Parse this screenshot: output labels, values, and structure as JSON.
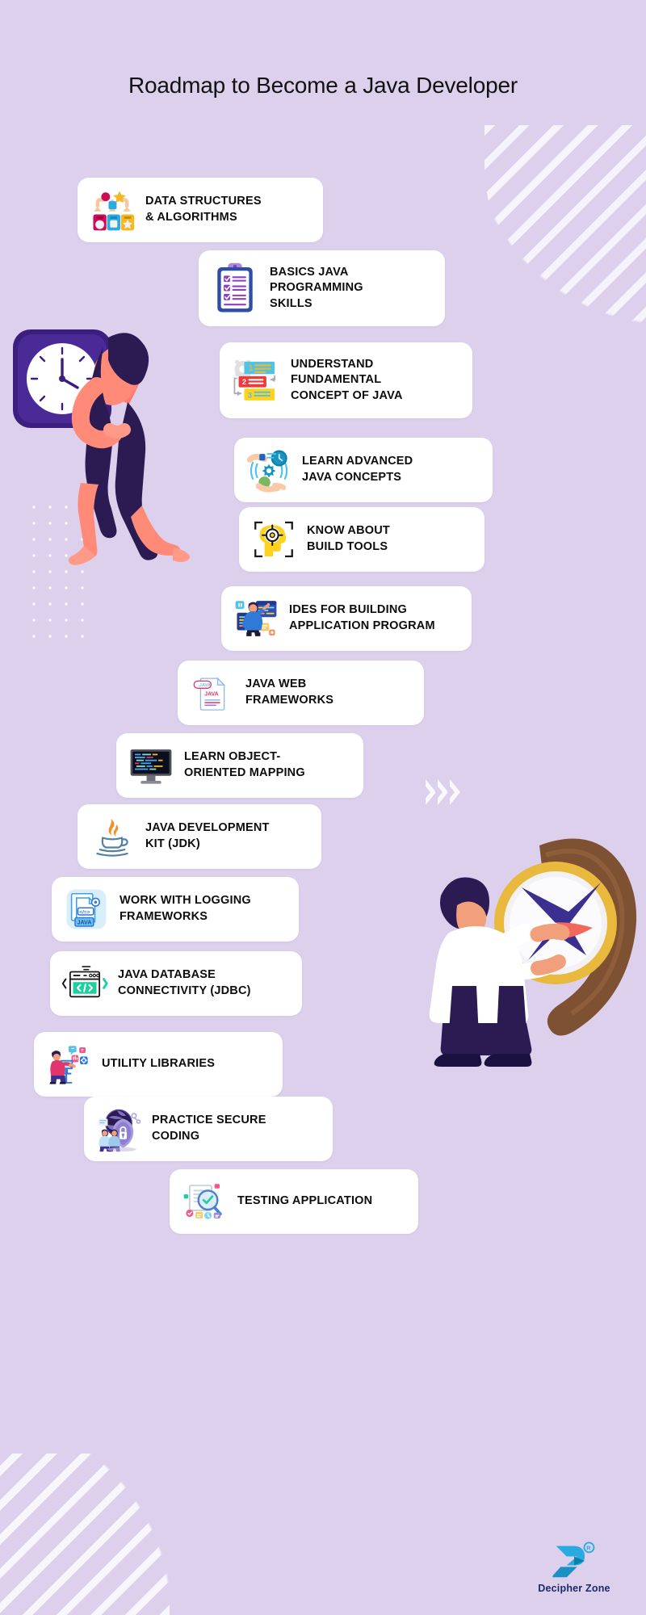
{
  "page": {
    "title": "Roadmap to Become a Java\nDeveloper",
    "background_color": "#DCD0EC",
    "card_color": "#FFFFFF",
    "text_color": "#0D0D0D"
  },
  "steps": [
    {
      "index": 1,
      "label": "DATA STRUCTURES\n& ALGORITHMS",
      "icon": "algorithm-flow-icon"
    },
    {
      "index": 2,
      "label": "BASICS JAVA\nPROGRAMMING\nSKILLS",
      "icon": "clipboard-checklist-icon"
    },
    {
      "index": 3,
      "label": "UNDERSTAND\nFUNDAMENTAL\nCONCEPT OF JAVA",
      "icon": "numbered-steps-gear-icon"
    },
    {
      "index": 4,
      "label": "LEARN ADVANCED\nJAVA CONCEPTS",
      "icon": "gear-clock-hands-icon"
    },
    {
      "index": 5,
      "label": "KNOW ABOUT\nBUILD TOOLS",
      "icon": "head-target-icon"
    },
    {
      "index": 6,
      "label": "IDES FOR BUILDING\nAPPLICATION PROGRAM",
      "icon": "developer-screens-icon"
    },
    {
      "index": 7,
      "label": "JAVA WEB\nFRAMEWORKS",
      "icon": "java-file-icon"
    },
    {
      "index": 8,
      "label": "LEARN OBJECT-\nORIENTED MAPPING",
      "icon": "monitor-code-icon"
    },
    {
      "index": 9,
      "label": "JAVA DEVELOPMENT\nKIT (JDK)",
      "icon": "java-coffee-cup-icon"
    },
    {
      "index": 10,
      "label": "WORK WITH LOGGING\nFRAMEWORKS",
      "icon": "java-documents-icon"
    },
    {
      "index": 11,
      "label": "JAVA DATABASE\nCONNECTIVITY (JDBC)",
      "icon": "code-window-icon"
    },
    {
      "index": 12,
      "label": "UTILITY LIBRARIES",
      "icon": "person-desk-icon"
    },
    {
      "index": 13,
      "label": "PRACTICE SECURE\nCODING",
      "icon": "globe-shield-lock-icon"
    },
    {
      "index": 14,
      "label": "TESTING APPLICATION",
      "icon": "testing-magnifier-icon"
    }
  ],
  "illustrations": [
    {
      "name": "woman-holding-clock-illustration"
    },
    {
      "name": "man-with-wristwatch-illustration"
    }
  ],
  "decorations": [
    {
      "name": "diagonal-stripes-top-right"
    },
    {
      "name": "dot-grid-left"
    },
    {
      "name": "chevron-arrows-right"
    },
    {
      "name": "diagonal-stripes-bottom-left"
    }
  ],
  "logo": {
    "name": "Decipher Zone",
    "accent_color": "#29ABE2",
    "text_color": "#1B2A6B"
  }
}
